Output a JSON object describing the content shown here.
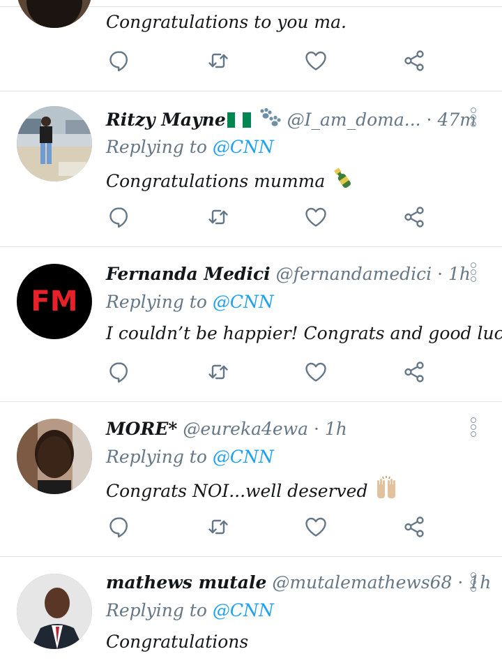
{
  "tweets": [
    {
      "name": "",
      "handle": "",
      "time": "",
      "replying_prefix": "",
      "replying_to": "",
      "text": "Congratulations to you ma."
    },
    {
      "name": "Ritzy Mayne",
      "handle": "@I_am_doma...",
      "time": "47m",
      "replying_prefix": "Replying to ",
      "replying_to": "@CNN",
      "text": "Congratulations mumma"
    },
    {
      "name": "Fernanda Medici",
      "handle": "@fernandamedici",
      "time": "1h",
      "replying_prefix": "Replying to ",
      "replying_to": "@CNN",
      "text": "I couldn’t be happier! Congrats and good luck!",
      "avatar_text": "FM"
    },
    {
      "name": "MORE*",
      "handle": "@eureka4ewa",
      "time": "1h",
      "replying_prefix": "Replying to ",
      "replying_to": "@CNN",
      "text": "Congrats NOI...well deserved"
    },
    {
      "name": "mathews mutale",
      "handle": "@mutalemathews68",
      "time": "1h",
      "replying_prefix": "Replying to ",
      "replying_to": "@CNN",
      "text": "Congratulations"
    }
  ],
  "separator": "·",
  "icons": [
    "reply-icon",
    "retweet-icon",
    "like-icon",
    "share-icon",
    "more-options-icon",
    "nigeria-flag-icon",
    "paw-prints-icon",
    "champagne-icon",
    "raised-hands-icon"
  ],
  "colors": {
    "mention": "#1da1f2",
    "secondary_text": "#657786",
    "icon": "#657786",
    "divider": "#dfe3e6",
    "fm_red": "#e8202a"
  }
}
